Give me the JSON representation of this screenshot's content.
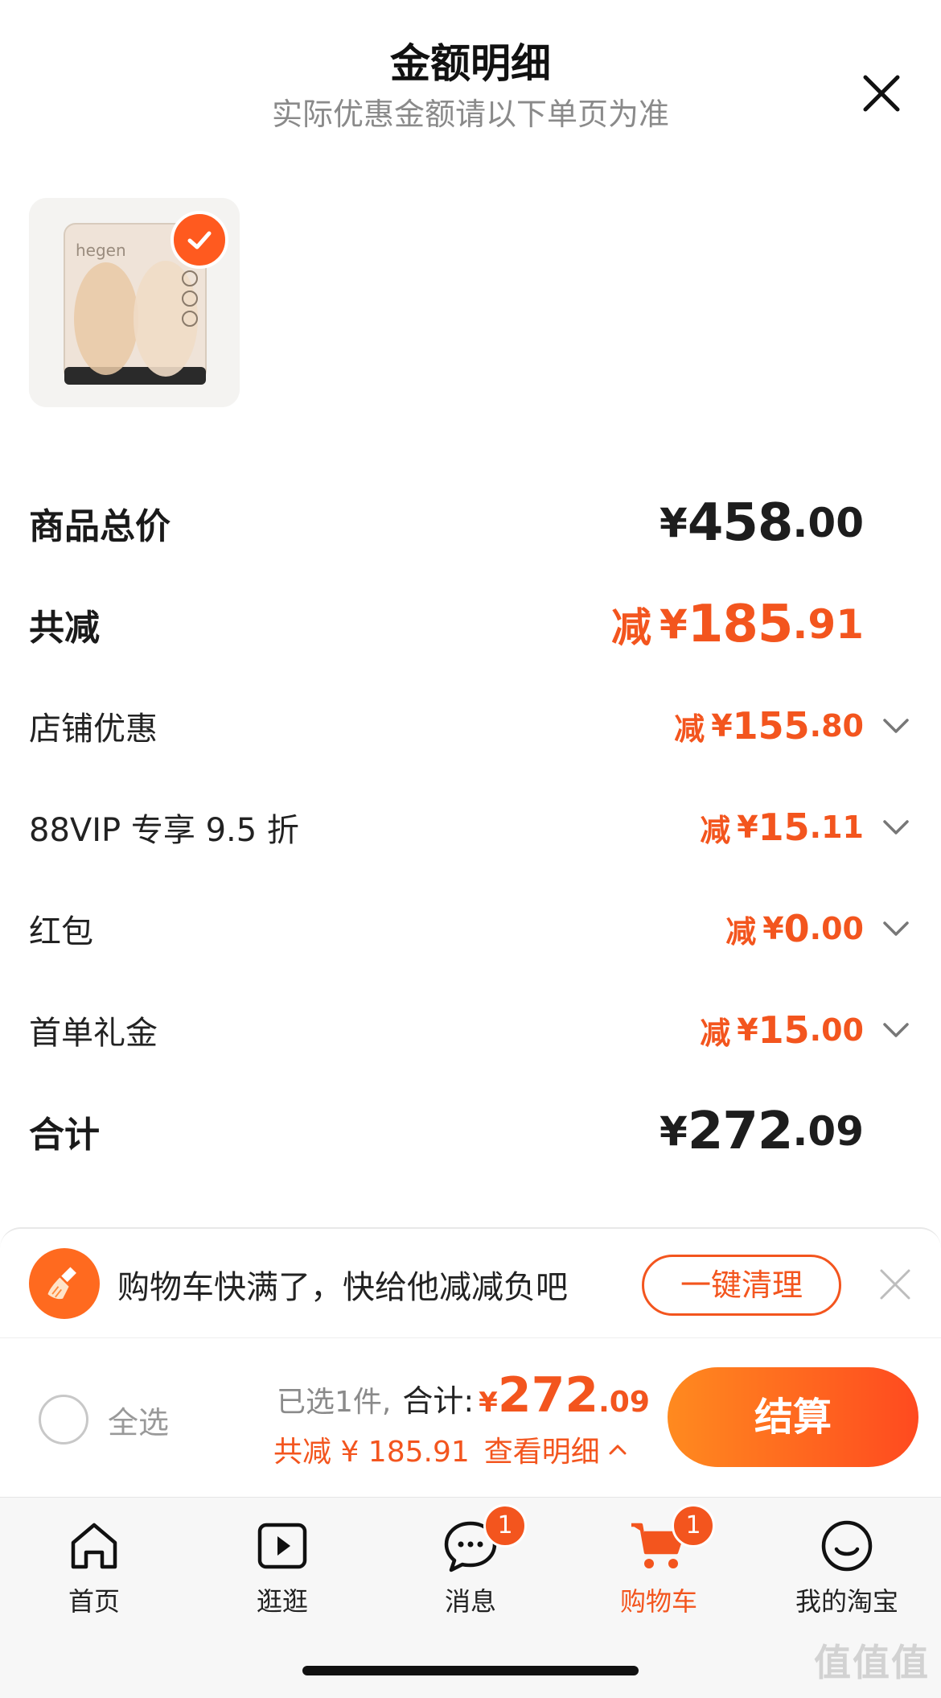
{
  "header": {
    "title": "金额明细",
    "subtitle": "实际优惠金额请以下单页为准"
  },
  "product": {
    "image_brand_text": "hegen",
    "selected": true
  },
  "breakdown": {
    "goods_total": {
      "label": "商品总价",
      "yen": "¥",
      "main": "458",
      "dec": ".00"
    },
    "total_reduction": {
      "label": "共减",
      "prefix": "减",
      "yen": "¥",
      "main": "185",
      "dec": ".91"
    },
    "items": [
      {
        "label": "店铺优惠",
        "prefix": "减",
        "yen": "¥",
        "main": "155",
        "dec": ".80"
      },
      {
        "label": "88VIP 专享 9.5 折",
        "prefix": "减",
        "yen": "¥",
        "main": "15",
        "dec": ".11"
      },
      {
        "label": "红包",
        "prefix": "减",
        "yen": "¥",
        "main": "0",
        "dec": ".00"
      },
      {
        "label": "首单礼金",
        "prefix": "减",
        "yen": "¥",
        "main": "15",
        "dec": ".00"
      }
    ],
    "sum": {
      "label": "合计",
      "yen": "¥",
      "main": "272",
      "dec": ".09"
    }
  },
  "notice": {
    "text": "购物车快满了，快给他减减负吧",
    "button": "一键清理"
  },
  "checkout": {
    "select_all": "全选",
    "selected_count_text": "已选1件,",
    "total_label": "合计:",
    "yen": "¥",
    "total_main": "272",
    "total_dec": ".09",
    "reduction_text": "共减 ¥ 185.91",
    "detail_link": "查看明细",
    "pay_button": "结算"
  },
  "tabbar": {
    "tabs": [
      {
        "label": "首页",
        "icon": "home-icon",
        "badge": ""
      },
      {
        "label": "逛逛",
        "icon": "play-icon",
        "badge": ""
      },
      {
        "label": "消息",
        "icon": "chat-icon",
        "badge": "1"
      },
      {
        "label": "购物车",
        "icon": "cart-icon",
        "badge": "1",
        "active": true
      },
      {
        "label": "我的淘宝",
        "icon": "smile-icon",
        "badge": ""
      }
    ]
  },
  "watermark": "值值值",
  "colors": {
    "accent": "#f3551e",
    "pay_gradient_start": "#ff8a1f",
    "pay_gradient_end": "#ff4a1f"
  }
}
